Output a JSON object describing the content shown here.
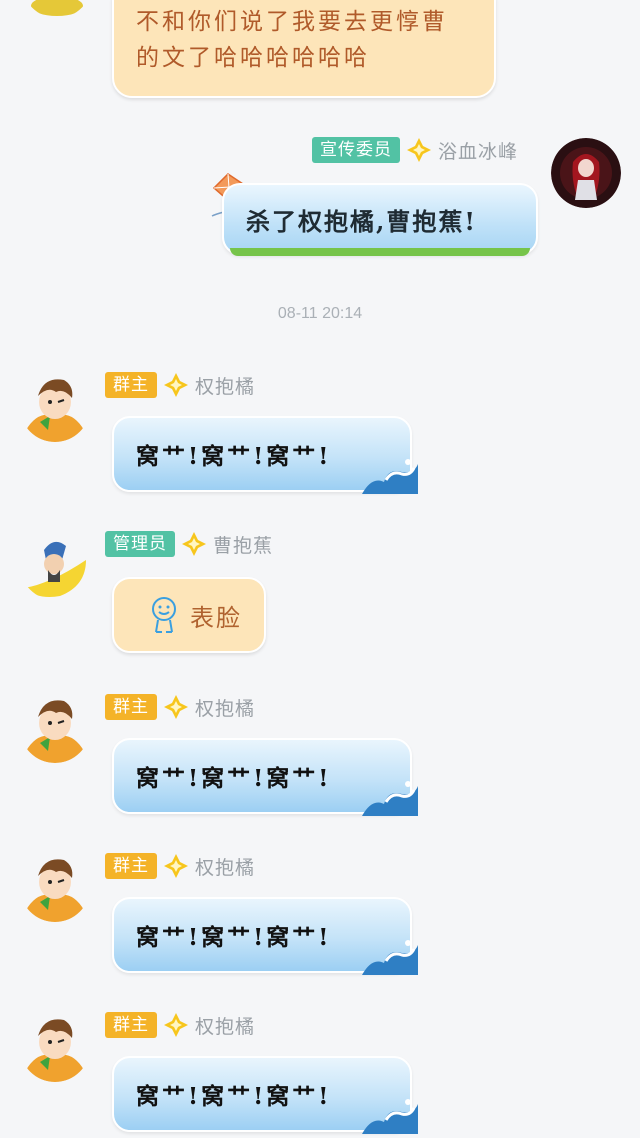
{
  "colors": {
    "background": "#f5f6f8",
    "owner_badge": "#f4b328",
    "admin_badge": "#52c2a4",
    "orange_bubble": "#fde5b9",
    "blue_bubble": "#c4e3f8",
    "sender_name": "#9aa0a6"
  },
  "first_message": {
    "text": "不和你们说了我要去更惇曹的文了哈哈哈哈哈哈"
  },
  "sent_message": {
    "badge": "宣传委员",
    "sender": "浴血冰峰",
    "text": "杀了权抱橘,曹抱蕉!"
  },
  "timestamp": "08-11 20:14",
  "messages": [
    {
      "badge": "群主",
      "sender": "权抱橘",
      "text": "窝艹!窝艹!窝艹!"
    },
    {
      "badge": "管理员",
      "sender": "曹抱蕉",
      "text": "表脸",
      "icon": "smiley-face-icon"
    },
    {
      "badge": "群主",
      "sender": "权抱橘",
      "text": "窝艹!窝艹!窝艹!"
    },
    {
      "badge": "群主",
      "sender": "权抱橘",
      "text": "窝艹!窝艹!窝艹!"
    },
    {
      "badge": "群主",
      "sender": "权抱橘",
      "text": "窝艹!窝艹!窝艹!"
    }
  ]
}
